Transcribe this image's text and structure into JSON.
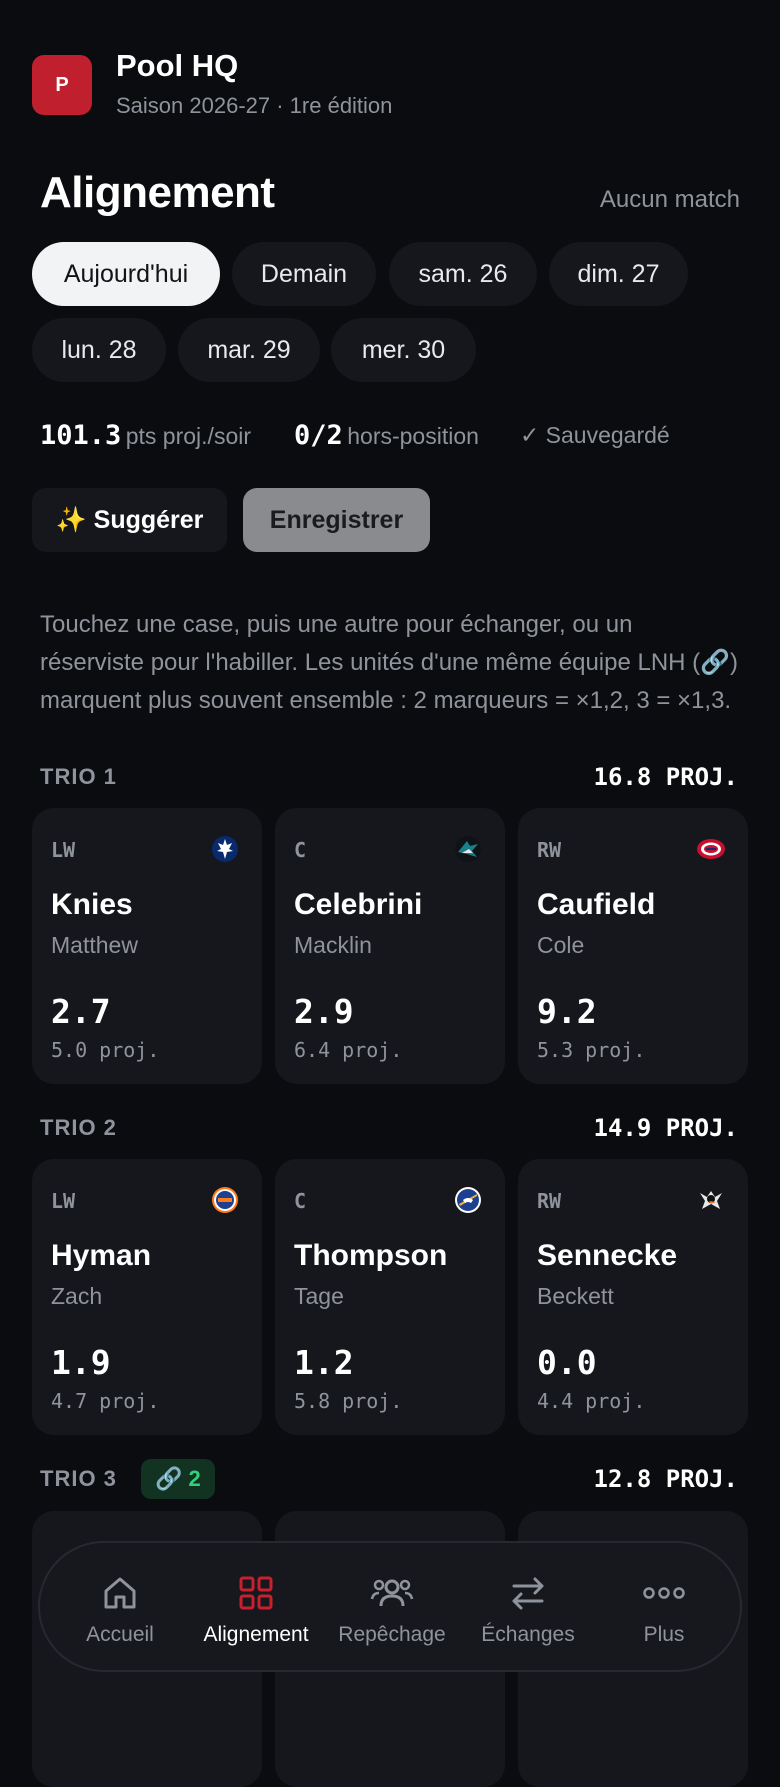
{
  "app": {
    "logo_letter": "P",
    "title": "Pool HQ",
    "subtitle": "Saison 2026-27 · 1re édition",
    "accent": "#c0202e"
  },
  "page": {
    "title": "Alignement",
    "status": "Aucun match"
  },
  "days": [
    {
      "label": "Aujourd'hui",
      "active": true
    },
    {
      "label": "Demain",
      "active": false
    },
    {
      "label": "sam. 26",
      "active": false
    },
    {
      "label": "dim. 27",
      "active": false
    },
    {
      "label": "lun. 28",
      "active": false
    },
    {
      "label": "mar. 29",
      "active": false
    },
    {
      "label": "mer. 30",
      "active": false
    }
  ],
  "stats": {
    "pts_value": "101.3",
    "pts_label": "pts proj./soir",
    "offpos_value": "0/2",
    "offpos_label": "hors-position",
    "saved_label": "✓ Sauvegardé"
  },
  "actions": {
    "suggest_label": "✨ Suggérer",
    "save_label": "Enregistrer"
  },
  "hint": "Touchez une case, puis une autre pour échanger, ou un réserviste pour l'habiller. Les unités d'une même équipe LNH (🔗) marquent plus souvent ensemble : 2 marqueurs = ×1,2, 3 = ×1,3.",
  "trios": [
    {
      "label": "TRIO 1",
      "proj": "16.8 PROJ.",
      "players": [
        {
          "pos": "LW",
          "last": "Knies",
          "first": "Matthew",
          "pts": "2.7",
          "proj": "5.0 proj.",
          "team_icon": "maple-leafs-logo"
        },
        {
          "pos": "C",
          "last": "Celebrini",
          "first": "Macklin",
          "pts": "2.9",
          "proj": "6.4 proj.",
          "team_icon": "sharks-logo"
        },
        {
          "pos": "RW",
          "last": "Caufield",
          "first": "Cole",
          "pts": "9.2",
          "proj": "5.3 proj.",
          "team_icon": "canadiens-logo"
        }
      ]
    },
    {
      "label": "TRIO 2",
      "proj": "14.9 PROJ.",
      "players": [
        {
          "pos": "LW",
          "last": "Hyman",
          "first": "Zach",
          "pts": "1.9",
          "proj": "4.7 proj.",
          "team_icon": "oilers-logo"
        },
        {
          "pos": "C",
          "last": "Thompson",
          "first": "Tage",
          "pts": "1.2",
          "proj": "5.8 proj.",
          "team_icon": "sabres-logo"
        },
        {
          "pos": "RW",
          "last": "Sennecke",
          "first": "Beckett",
          "pts": "0.0",
          "proj": "4.4 proj.",
          "team_icon": "ducks-logo"
        }
      ]
    },
    {
      "label": "TRIO 3",
      "badge": "🔗 2",
      "proj": "12.8 PROJ."
    }
  ],
  "nav": [
    {
      "label": "Accueil",
      "icon": "home-icon",
      "active": false
    },
    {
      "label": "Alignement",
      "icon": "grid-icon",
      "active": true
    },
    {
      "label": "Repêchage",
      "icon": "users-icon",
      "active": false
    },
    {
      "label": "Échanges",
      "icon": "swap-icon",
      "active": false
    },
    {
      "label": "Plus",
      "icon": "more-icon",
      "active": false
    }
  ]
}
